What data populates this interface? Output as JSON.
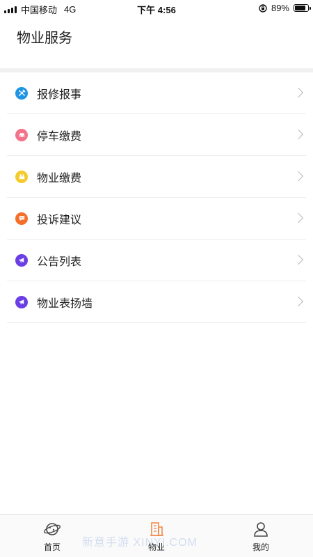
{
  "status_bar": {
    "carrier": "中国移动",
    "network": "4G",
    "time": "下午 4:56",
    "battery": "89%",
    "battery_level": 0.89
  },
  "page_title": "物业服务",
  "menu": [
    {
      "label": "报修报事",
      "icon": "tools-icon",
      "color": "#1f95e6"
    },
    {
      "label": "停车缴费",
      "icon": "car-icon",
      "color": "#f2738a"
    },
    {
      "label": "物业缴费",
      "icon": "building-icon",
      "color": "#f5cb2c"
    },
    {
      "label": "投诉建议",
      "icon": "chat-icon",
      "color": "#f46f2a"
    },
    {
      "label": "公告列表",
      "icon": "megaphone-icon",
      "color": "#6b3ee6"
    },
    {
      "label": "物业表扬墙",
      "icon": "megaphone-icon",
      "color": "#6b3ee6"
    }
  ],
  "tab_bar": {
    "tabs": [
      {
        "label": "首页",
        "icon": "planet-icon",
        "active": false
      },
      {
        "label": "物业",
        "icon": "building-icon",
        "active": true
      },
      {
        "label": "我的",
        "icon": "user-icon",
        "active": false
      }
    ],
    "active_color": "#f08a4b"
  },
  "watermark": "新意手游 XINYI.COM"
}
